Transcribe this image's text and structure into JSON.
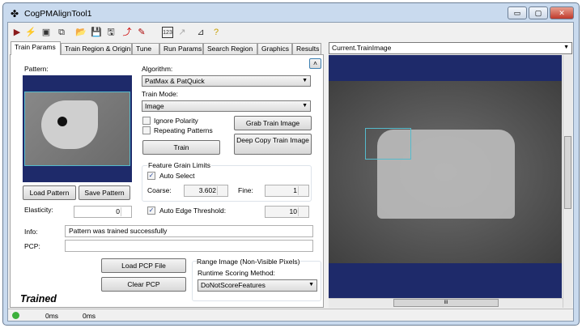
{
  "window": {
    "title": "CogPMAlignTool1",
    "minimize": "▭",
    "maximize": "▢",
    "close": "✕"
  },
  "toolbar": [
    {
      "icon": "run-icon",
      "glyph": "▶",
      "color": "#8b1a1a"
    },
    {
      "icon": "lightning-icon",
      "glyph": "⚡",
      "color": "#c8a000"
    },
    {
      "icon": "show-display-icon",
      "glyph": "▣",
      "color": "#333"
    },
    {
      "icon": "floating-icon",
      "glyph": "⧉",
      "color": "#333"
    },
    {
      "icon": "open-icon",
      "glyph": "📂",
      "color": "#c8a000"
    },
    {
      "icon": "save-icon",
      "glyph": "💾",
      "color": "#333"
    },
    {
      "icon": "save-as-icon",
      "glyph": "🖫",
      "color": "#333"
    },
    {
      "icon": "reset-icon",
      "glyph": "⤴",
      "color": "#c00"
    },
    {
      "icon": "edit-icon",
      "glyph": "✎",
      "color": "#a00"
    },
    {
      "icon": "counter-icon",
      "glyph": "123",
      "color": "#333"
    },
    {
      "icon": "graph-icon",
      "glyph": "↗",
      "color": "#aaa"
    },
    {
      "icon": "calibrate-icon",
      "glyph": "⊿",
      "color": "#333"
    },
    {
      "icon": "help-icon",
      "glyph": "?",
      "color": "#c8a000"
    }
  ],
  "tabs": [
    "Train Params",
    "Train Region & Origin",
    "Tune",
    "Run Params",
    "Search Region",
    "Graphics",
    "Results"
  ],
  "left": {
    "pattern_label": "Pattern:",
    "load_pattern": "Load Pattern",
    "save_pattern": "Save Pattern",
    "elasticity_label": "Elasticity:",
    "elasticity": "0",
    "algorithm_label": "Algorithm:",
    "algorithm": "PatMax & PatQuick",
    "train_mode_label": "Train Mode:",
    "train_mode": "Image",
    "ignore_polarity": "Ignore Polarity",
    "repeating_patterns": "Repeating Patterns",
    "grab_train_image": "Grab Train Image",
    "train": "Train",
    "deep_copy": "Deep Copy Train Image",
    "fgl_title": "Feature Grain Limits",
    "auto_select": "Auto Select",
    "coarse_label": "Coarse:",
    "coarse": "3.602",
    "fine_label": "Fine:",
    "fine": "1",
    "auto_edge": "Auto Edge Threshold:",
    "edge": "10",
    "info_label": "Info:",
    "info": "Pattern was trained successfully",
    "pcp_label": "PCP:",
    "pcp": "",
    "load_pcp": "Load PCP File",
    "clear_pcp": "Clear PCP",
    "range_title": "Range Image (Non-Visible Pixels)",
    "scoring_label": "Runtime Scoring Method:",
    "scoring": "DoNotScoreFeatures",
    "state": "Trained"
  },
  "right": {
    "image_select": "Current.TrainImage",
    "scroll_thumb": "III"
  },
  "status": {
    "t1": "0ms",
    "t2": "0ms",
    "color": "#3cb03c"
  }
}
